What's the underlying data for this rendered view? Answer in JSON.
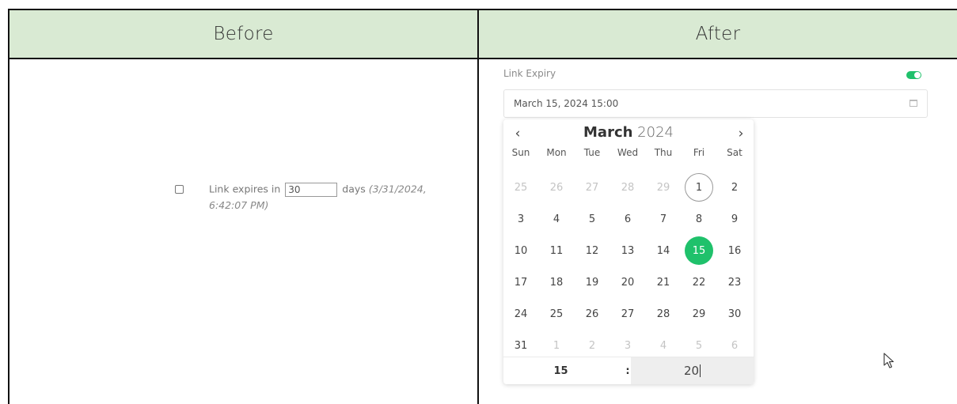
{
  "headers": {
    "before": "Before",
    "after": "After"
  },
  "before": {
    "label_prefix": "Link expires in",
    "days_value": "30",
    "label_suffix": "days",
    "date_line1": "(3/31/2024,",
    "date_line2": "6:42:07 PM)"
  },
  "after": {
    "expiry_label": "Link Expiry",
    "toggle_on": true,
    "date_value": "March 15, 2024 15:00",
    "picker": {
      "month": "March",
      "year": "2024",
      "prev_icon": "chevron-left-icon",
      "next_icon": "chevron-right-icon",
      "weekdays": [
        "Sun",
        "Mon",
        "Tue",
        "Wed",
        "Thu",
        "Fri",
        "Sat"
      ],
      "weeks": [
        [
          {
            "d": "25",
            "muted": true
          },
          {
            "d": "26",
            "muted": true
          },
          {
            "d": "27",
            "muted": true
          },
          {
            "d": "28",
            "muted": true
          },
          {
            "d": "29",
            "muted": true
          },
          {
            "d": "1",
            "today": true
          },
          {
            "d": "2"
          }
        ],
        [
          {
            "d": "3"
          },
          {
            "d": "4"
          },
          {
            "d": "5"
          },
          {
            "d": "6"
          },
          {
            "d": "7"
          },
          {
            "d": "8"
          },
          {
            "d": "9"
          }
        ],
        [
          {
            "d": "10"
          },
          {
            "d": "11"
          },
          {
            "d": "12"
          },
          {
            "d": "13"
          },
          {
            "d": "14"
          },
          {
            "d": "15",
            "selected": true
          },
          {
            "d": "16"
          }
        ],
        [
          {
            "d": "17"
          },
          {
            "d": "18"
          },
          {
            "d": "19"
          },
          {
            "d": "20"
          },
          {
            "d": "21"
          },
          {
            "d": "22"
          },
          {
            "d": "23"
          }
        ],
        [
          {
            "d": "24"
          },
          {
            "d": "25"
          },
          {
            "d": "26"
          },
          {
            "d": "27"
          },
          {
            "d": "28"
          },
          {
            "d": "29"
          },
          {
            "d": "30"
          }
        ],
        [
          {
            "d": "31"
          },
          {
            "d": "1",
            "muted": true
          },
          {
            "d": "2",
            "muted": true
          },
          {
            "d": "3",
            "muted": true
          },
          {
            "d": "4",
            "muted": true
          },
          {
            "d": "5",
            "muted": true
          },
          {
            "d": "6",
            "muted": true
          }
        ]
      ],
      "hour": "15",
      "separator": ":",
      "minute": "20"
    },
    "accent_color": "#1fc16b"
  }
}
